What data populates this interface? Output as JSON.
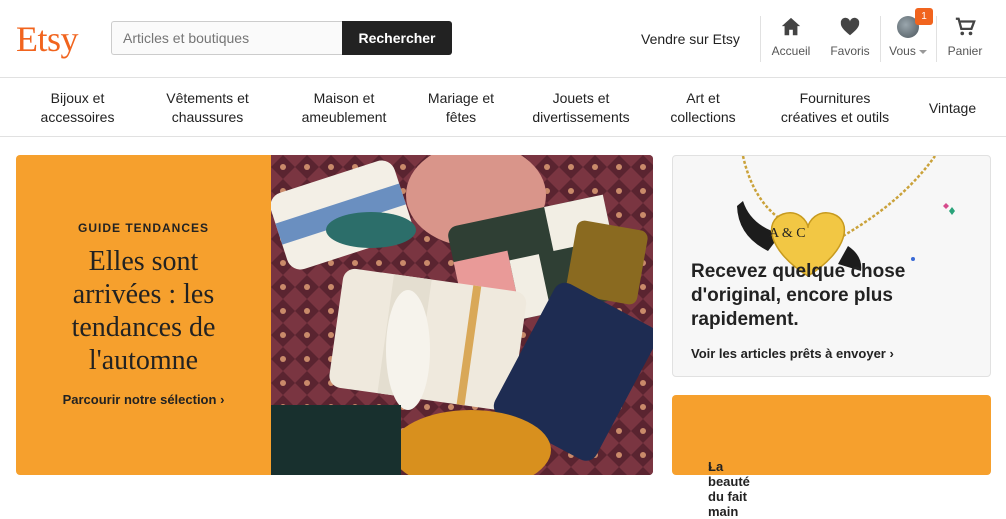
{
  "header": {
    "logo": "Etsy",
    "search_placeholder": "Articles et boutiques",
    "search_button": "Rechercher",
    "sell_link": "Vendre sur Etsy",
    "nav": {
      "home": "Accueil",
      "favorites": "Favoris",
      "you": "Vous",
      "cart": "Panier",
      "notifications_count": "1"
    }
  },
  "categories": [
    [
      "Bijoux et",
      "accessoires"
    ],
    [
      "Vêtements et",
      "chaussures"
    ],
    [
      "Maison et",
      "ameublement"
    ],
    [
      "Mariage et",
      "fêtes"
    ],
    [
      "Jouets et",
      "divertissements"
    ],
    [
      "Art et",
      "collections"
    ],
    [
      "Fournitures",
      "créatives et outils"
    ],
    [
      "Vintage",
      ""
    ]
  ],
  "hero": {
    "eyebrow": "GUIDE TENDANCES",
    "title": "Elles sont arrivées : les tendances de l'automne",
    "link": "Parcourir notre sélection",
    "image_alt": "pillows-photo"
  },
  "promo_card": {
    "pendant_text": "A & C",
    "title": "Recevez quelque chose d'original, encore plus rapidement.",
    "link": "Voir les articles prêts à envoyer"
  },
  "promo_orange": {
    "link": "La beauté du fait main"
  },
  "colors": {
    "brand": "#F1641E",
    "hero_orange": "#F6A02D"
  }
}
